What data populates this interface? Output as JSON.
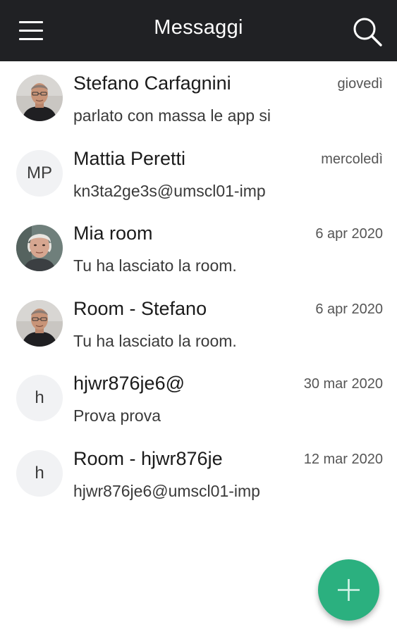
{
  "header": {
    "title": "Messaggi",
    "menu_icon": "hamburger-menu-icon",
    "search_icon": "search-icon",
    "background": "#202124"
  },
  "conversations": [
    {
      "name": "Stefano Carfagnini",
      "date": "giovedì",
      "preview": "parlato con massa le app si",
      "avatar_type": "photo-man-glasses",
      "initials": ""
    },
    {
      "name": "Mattia Peretti",
      "date": "mercoledì",
      "preview": "kn3ta2ge3s@umscl01-imp",
      "avatar_type": "initials",
      "initials": "MP"
    },
    {
      "name": "Mia room",
      "date": "6 apr 2020",
      "preview": "Tu ha lasciato la room.",
      "avatar_type": "photo-older-man",
      "initials": ""
    },
    {
      "name": "Room - Stefano",
      "date": "6 apr 2020",
      "preview": "Tu ha lasciato la room.",
      "avatar_type": "photo-man-glasses",
      "initials": ""
    },
    {
      "name": "hjwr876je6@",
      "date": "30 mar 2020",
      "preview": "Prova prova",
      "avatar_type": "initials",
      "initials": "h"
    },
    {
      "name": "Room - hjwr876je",
      "date": "12 mar 2020",
      "preview": "hjwr876je6@umscl01-imp",
      "avatar_type": "initials",
      "initials": "h"
    }
  ],
  "fab": {
    "icon": "plus-icon",
    "color": "#2bb07f"
  }
}
